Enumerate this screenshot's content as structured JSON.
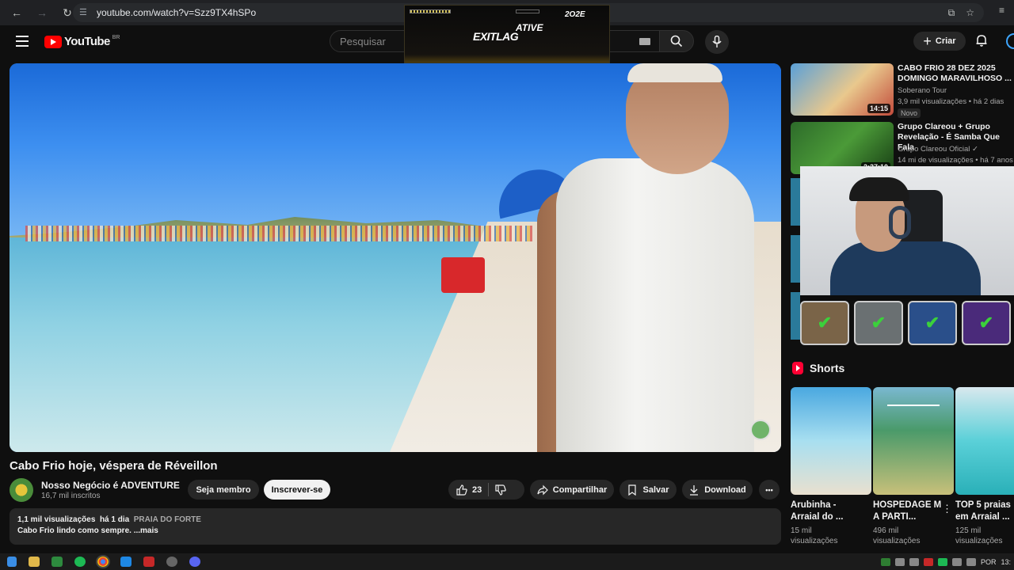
{
  "browser": {
    "url": "youtube.com/watch?v=Szz9TX4hSPo"
  },
  "overlay": {
    "year": "2O2E",
    "cta": "ATIVE",
    "brand": "EXITLAG"
  },
  "header": {
    "logo_text": "YouTube",
    "region": "BR",
    "search_placeholder": "Pesquisar",
    "create_label": "Criar"
  },
  "video": {
    "title": "Cabo Frio hoje, véspera de Réveillon",
    "channel_name": "Nosso Negócio é ADVENTURE",
    "subscribers": "16,7 mil inscritos",
    "member_label": "Seja membro",
    "subscribe_label": "Inscrever-se",
    "like_count": "23",
    "share_label": "Compartilhar",
    "save_label": "Salvar",
    "download_label": "Download",
    "more_label": "•••"
  },
  "description": {
    "views": "1,1 mil visualizações",
    "age": "há 1 dia",
    "tag": "PRAIA DO FORTE",
    "text": "Cabo Frio lindo como sempre.",
    "more": "...mais"
  },
  "recommendations": [
    {
      "title": "CABO FRIO 28 DEZ 2025 DOMINGO MARAVILHOSO ...",
      "channel": "Soberano Tour",
      "stats": "3,9 mil visualizações • há 2 dias",
      "duration": "14:15",
      "badge": "Novo"
    },
    {
      "title": "Grupo Clareou + Grupo Revelação - É Samba Que Fala",
      "channel": "Grupo Clareou Oficial ✓",
      "stats": "14 mi de visualizações • há 7 anos",
      "duration": "2:37:10"
    }
  ],
  "shorts": {
    "heading": "Shorts",
    "items": [
      {
        "title": "Arubinha - Arraial do ...",
        "views": "15 mil visualizações"
      },
      {
        "title": "HOSPEDAGE M A PARTI...",
        "views": "496 mil visualizações"
      },
      {
        "title": "TOP 5 praias em Arraial ...",
        "views": "125 mil visualizações"
      }
    ]
  },
  "taskbar": {
    "language": "POR",
    "time": "13:"
  },
  "colors": {
    "background": "#0f0f0f",
    "accent": "#ff0000",
    "chip": "#272727",
    "check": "#3bd13b"
  }
}
